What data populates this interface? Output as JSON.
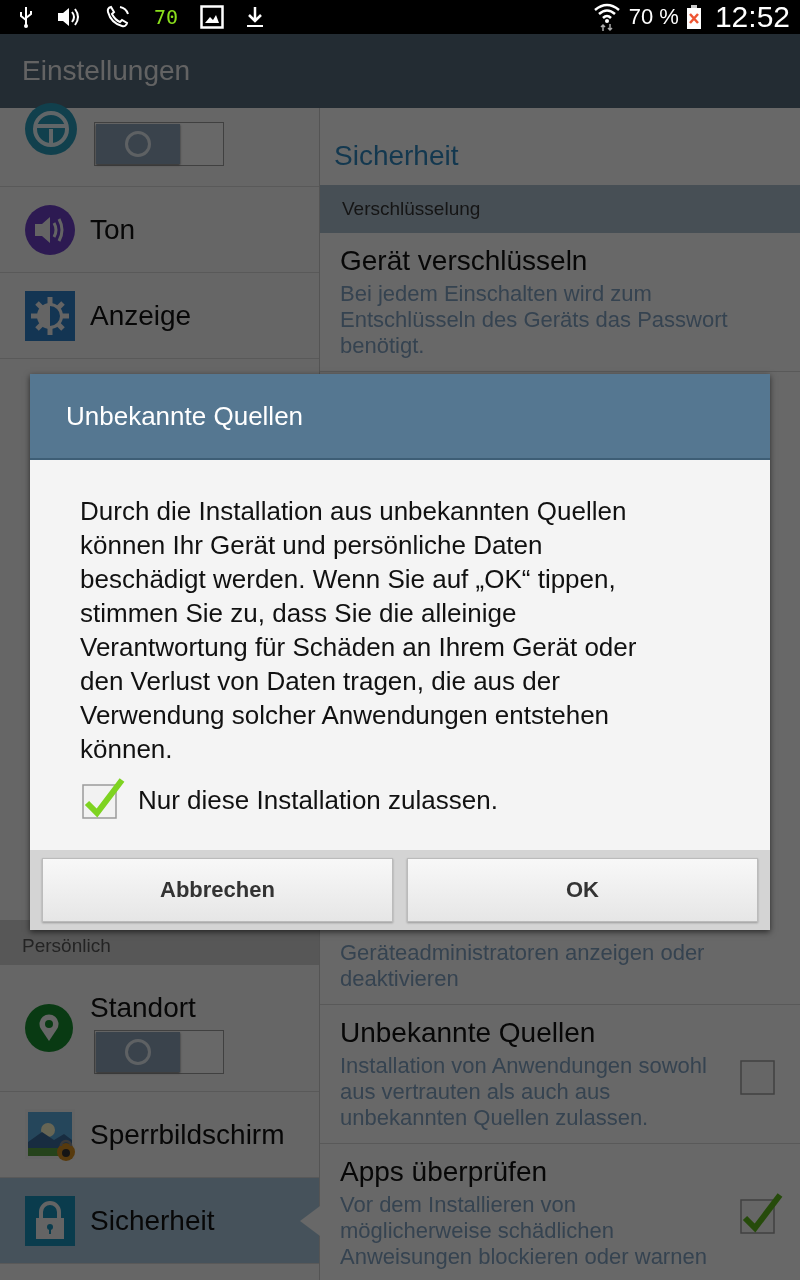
{
  "status_bar": {
    "indicator": "70",
    "battery": "70 %",
    "time": "12:52"
  },
  "app_bar": {
    "title": "Einstellungen"
  },
  "sidebar": {
    "groups": [
      {
        "items": [
          {
            "kind": "toggle",
            "on": false,
            "selected": false
          },
          {
            "kind": "plain",
            "label": "Ton",
            "selected": false
          },
          {
            "kind": "plain",
            "label": "Anzeige",
            "selected": false
          }
        ]
      },
      {
        "header": "Persönlich",
        "items": [
          {
            "kind": "toggle",
            "label": "Standort",
            "on": false,
            "selected": false
          },
          {
            "kind": "plain",
            "label": "Sperrbildschirm",
            "selected": false
          },
          {
            "kind": "plain",
            "label": "Sicherheit",
            "selected": true
          }
        ]
      }
    ]
  },
  "detail": {
    "title": "Sicherheit",
    "groups": [
      {
        "header": "Verschlüsselung",
        "items": [
          {
            "title": "Gerät verschlüsseln",
            "summary": "Bei jedem Einschalten wird zum Entschlüsseln des Geräts das Passwort benötigt."
          }
        ]
      },
      {
        "items": [
          {
            "summary": "Geräteadministratoren anzeigen oder deaktivieren"
          },
          {
            "title": "Unbekannte Quellen",
            "summary": "Installation von Anwendungen sowohl aus vertrauten als auch aus unbekannten Quellen zulassen.",
            "checked": false
          },
          {
            "title": "Apps überprüfen",
            "summary": "Vor dem Installieren von möglicherweise schädlichen Anweisungen blockieren oder warnen",
            "checked": true
          }
        ]
      }
    ]
  },
  "dialog": {
    "title": "Unbekannte Quellen",
    "message": "Durch die Installation aus unbekannten Quellen können Ihr Gerät und persönliche Daten beschädigt werden. Wenn Sie auf „OK“ tippen, stimmen Sie zu, dass Sie die alleinige Verantwortung für Schäden an Ihrem Gerät oder den Verlust von Daten tragen, die aus der Verwendung solcher Anwendungen entstehen können.",
    "checkbox": {
      "label": "Nur diese Installation zulassen.",
      "checked": true
    },
    "buttons": [
      "Abbrechen",
      "OK"
    ]
  }
}
